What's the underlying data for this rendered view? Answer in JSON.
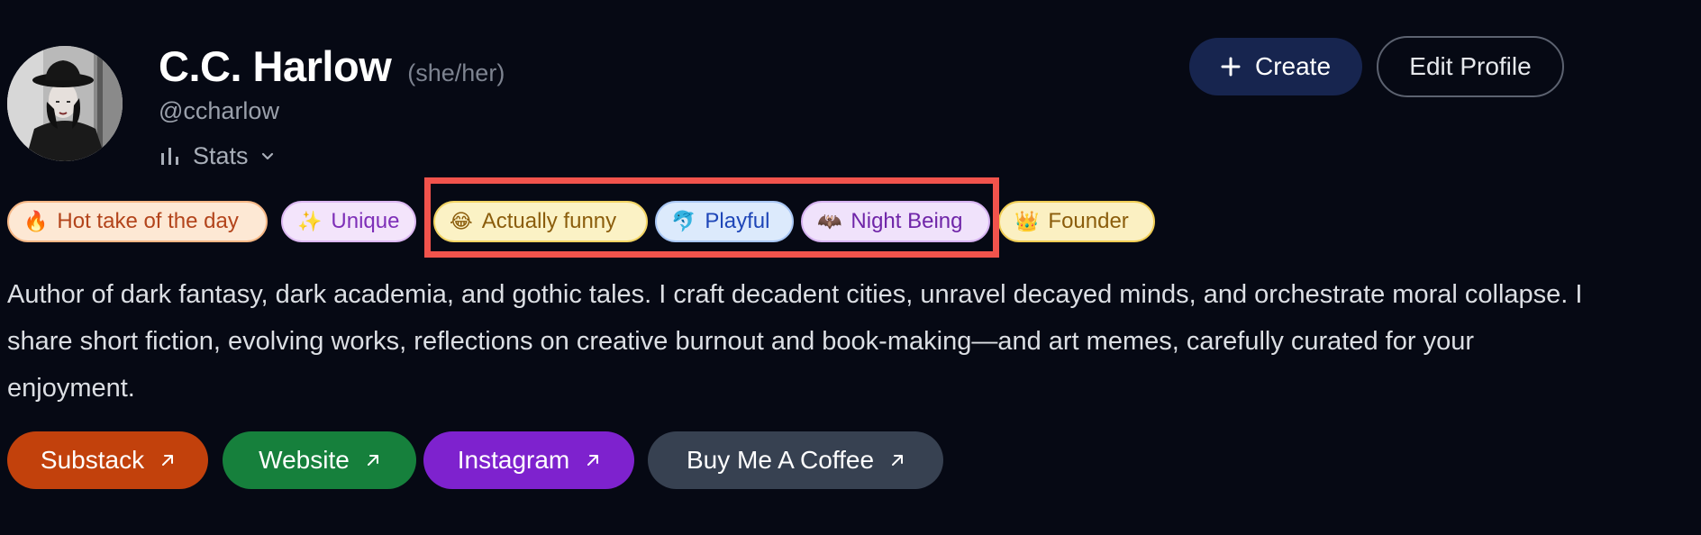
{
  "profile": {
    "display_name": "C.C. Harlow",
    "pronouns": "(she/her)",
    "handle": "@ccharlow",
    "stats_label": "Stats"
  },
  "actions": {
    "create_label": "Create",
    "edit_label": "Edit Profile"
  },
  "badges": [
    {
      "emoji": "🔥",
      "label": "Hot take of the day"
    },
    {
      "emoji": "✨",
      "label": "Unique"
    },
    {
      "emoji": "😂",
      "label": "Actually funny"
    },
    {
      "emoji": "🐬",
      "label": "Playful"
    },
    {
      "emoji": "🦇",
      "label": "Night Being"
    },
    {
      "emoji": "👑",
      "label": "Founder"
    }
  ],
  "bio": "Author of dark fantasy, dark academia, and gothic tales. I craft decadent cities, unravel decayed minds, and orchestrate moral collapse. I share short fiction, evolving works, reflections on creative burnout and book-making—and art memes, carefully curated for your enjoyment.",
  "links": [
    {
      "label": "Substack",
      "color": "#c2410c"
    },
    {
      "label": "Website",
      "color": "#16803c"
    },
    {
      "label": "Instagram",
      "color": "#7e22ce"
    },
    {
      "label": "Buy Me A Coffee",
      "color": "#374151"
    }
  ],
  "icons": {
    "stats": "bar-chart-icon",
    "stats_toggle": "chevron-down-icon",
    "create": "plus-icon",
    "link": "external-arrow-icon"
  },
  "colors": {
    "background": "#060914",
    "highlight": "#f1534c"
  }
}
